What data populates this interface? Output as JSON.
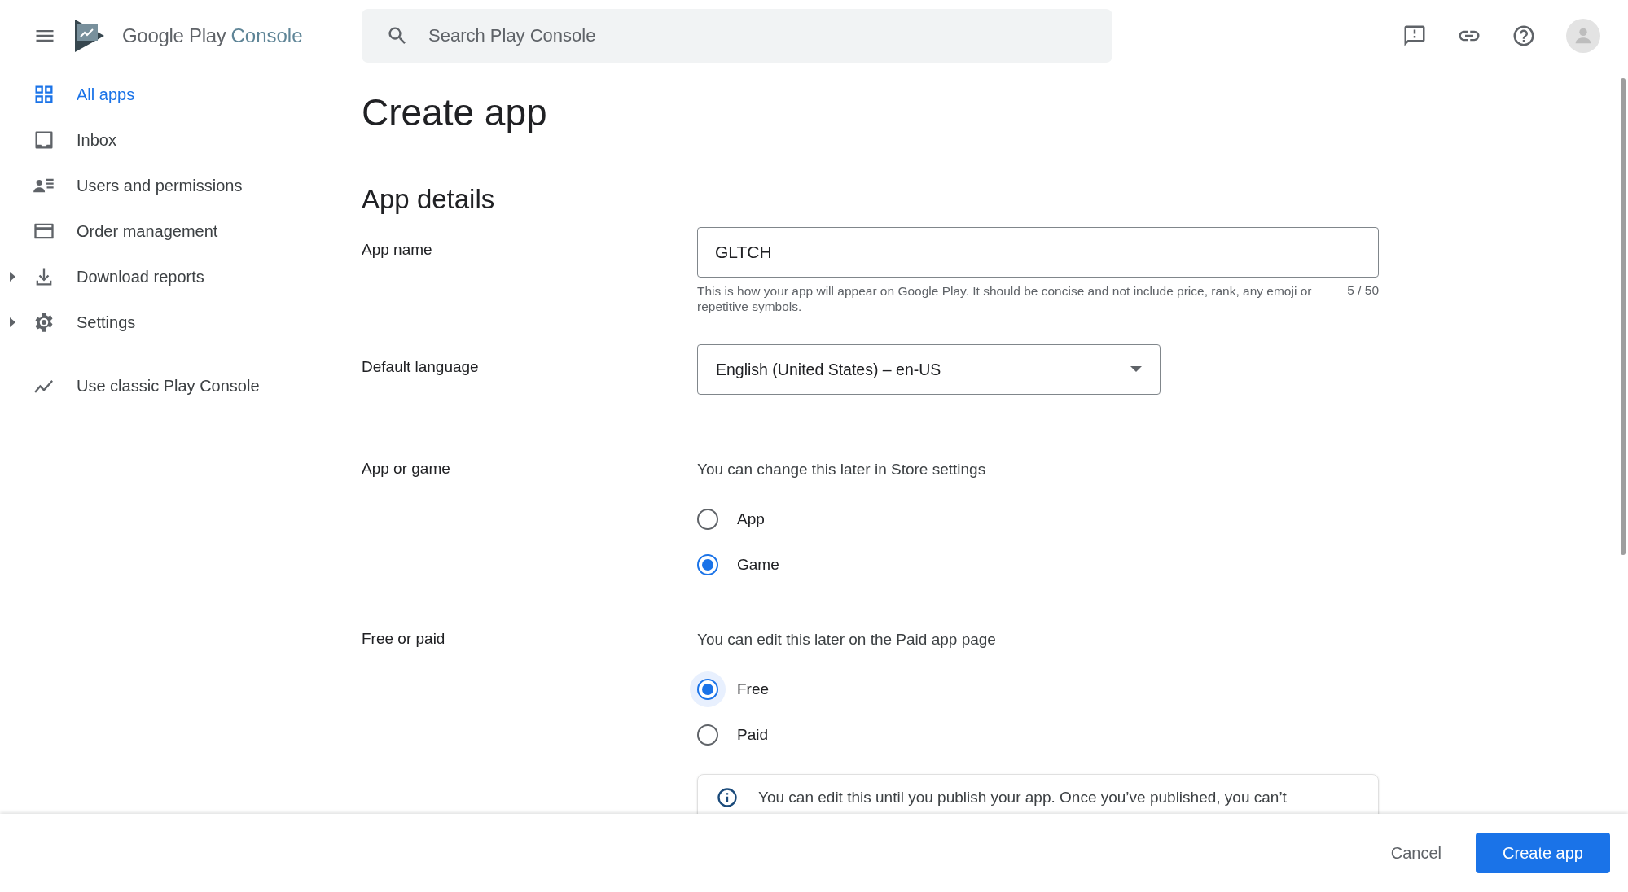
{
  "header": {
    "logo": {
      "brand": "Google Play",
      "product": "Console"
    },
    "search": {
      "placeholder": "Search Play Console"
    }
  },
  "nav": [
    {
      "label": "All apps",
      "kind": "grid",
      "selected": true,
      "expandable": false
    },
    {
      "label": "Inbox",
      "kind": "inbox",
      "selected": false,
      "expandable": false
    },
    {
      "label": "Users and permissions",
      "kind": "users",
      "selected": false,
      "expandable": false
    },
    {
      "label": "Order management",
      "kind": "card",
      "selected": false,
      "expandable": false
    },
    {
      "label": "Download reports",
      "kind": "download",
      "selected": false,
      "expandable": true
    },
    {
      "label": "Settings",
      "kind": "gear",
      "selected": false,
      "expandable": true
    }
  ],
  "classic_link": {
    "label": "Use classic Play Console"
  },
  "page": {
    "title": "Create app",
    "section": "App details",
    "fields": [
      {
        "kind": "text",
        "label": "App name",
        "value": "GLTCH",
        "helper": "This is how your app will appear on Google Play. It should be concise and not include price, rank, any emoji or repetitive symbols.",
        "counter": "5 / 50"
      },
      {
        "kind": "select",
        "label": "Default language",
        "value": "English (United States) – en-US"
      },
      {
        "kind": "radio",
        "label": "App or game",
        "hint": "You can change this later in Store settings",
        "options": [
          {
            "label": "App",
            "selected": false,
            "focused": false
          },
          {
            "label": "Game",
            "selected": true,
            "focused": false
          }
        ]
      },
      {
        "kind": "radio",
        "label": "Free or paid",
        "hint": "You can edit this later on the Paid app page",
        "options": [
          {
            "label": "Free",
            "selected": true,
            "focused": true
          },
          {
            "label": "Paid",
            "selected": false,
            "focused": false
          }
        ],
        "notice": "You can edit this until you publish your app. Once you’ve published, you can’t"
      }
    ]
  },
  "footer": {
    "buttons": [
      {
        "label": "Cancel",
        "kind": "text"
      },
      {
        "label": "Create app",
        "kind": "primary"
      }
    ]
  }
}
